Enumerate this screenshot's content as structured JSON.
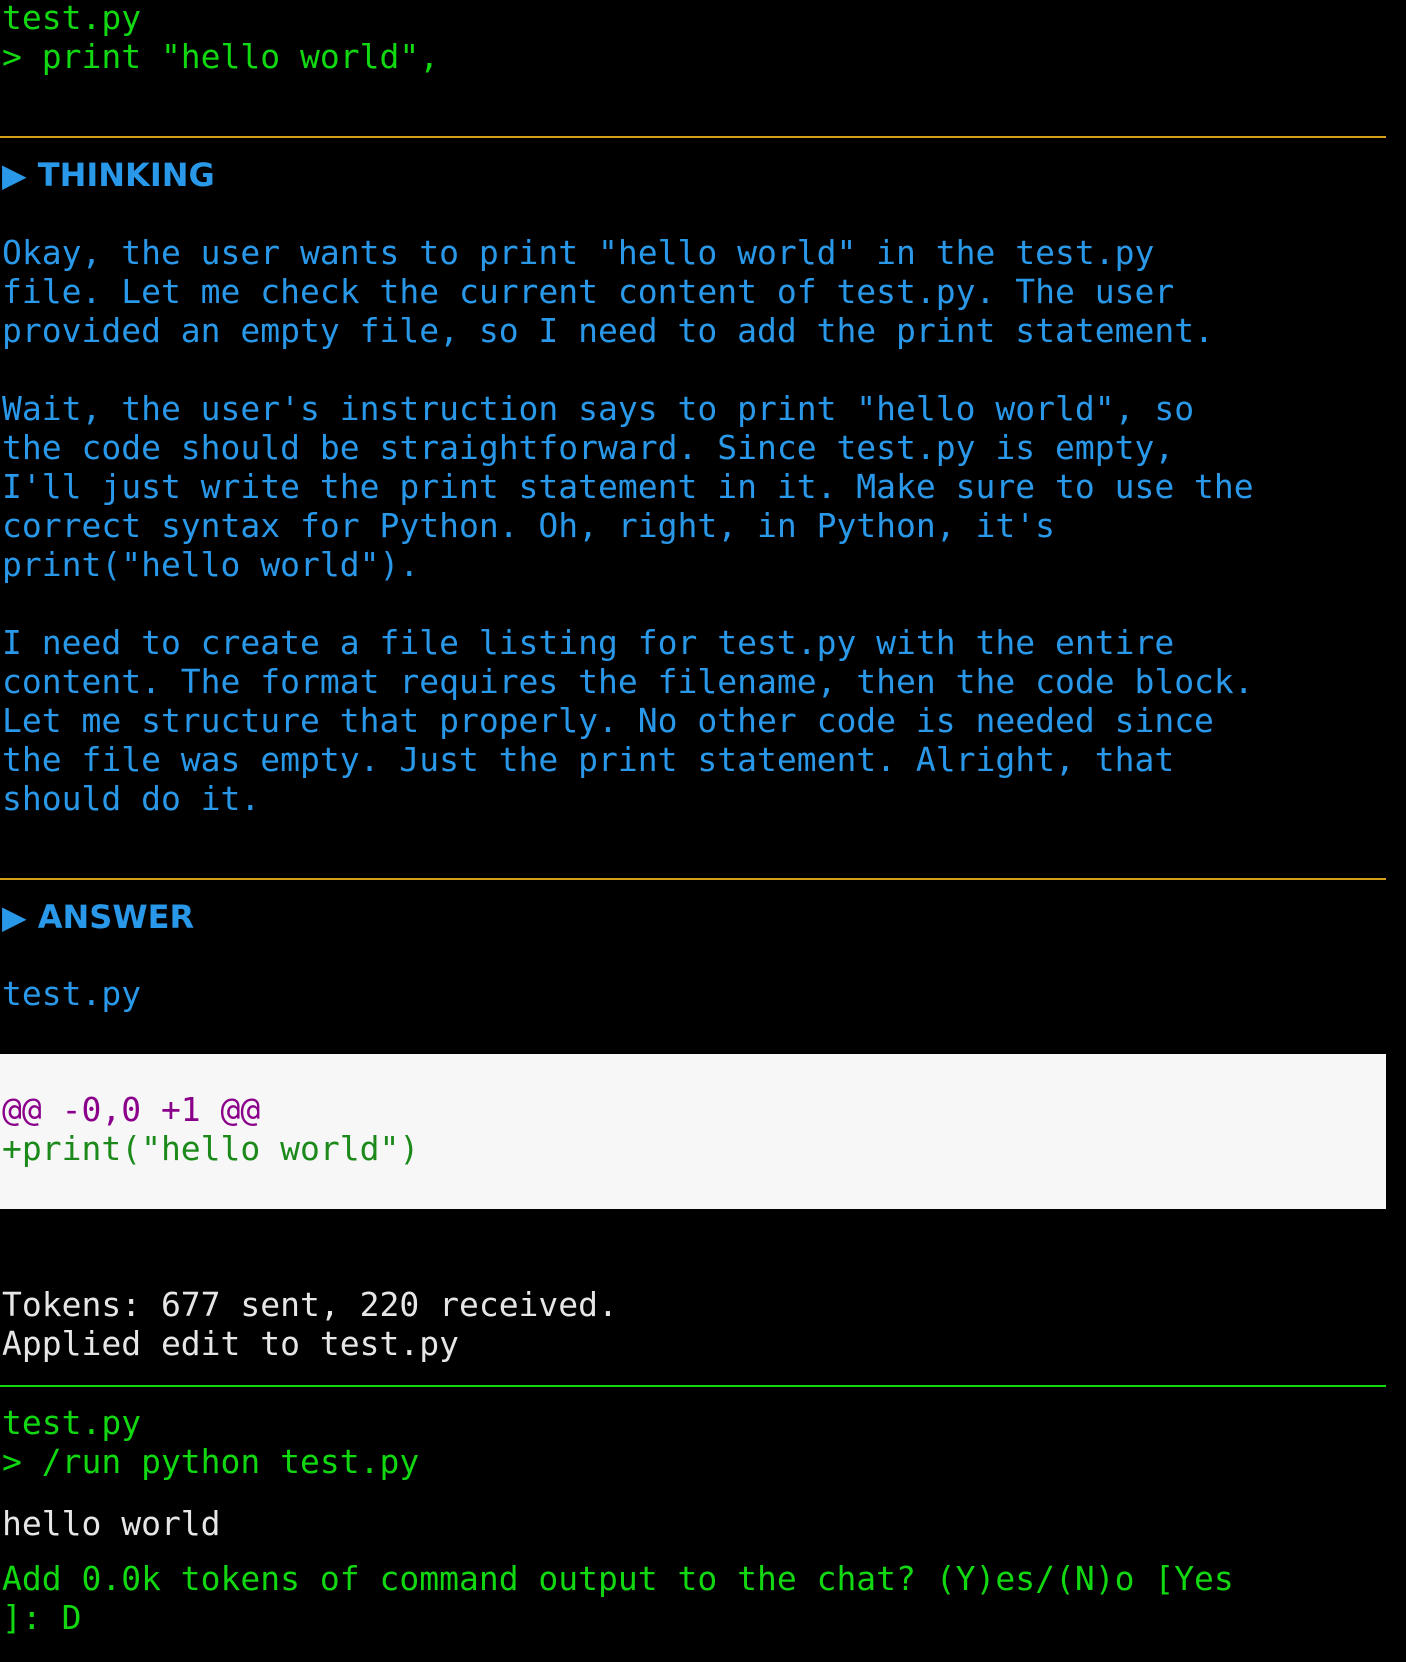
{
  "prompt1": {
    "filename": "test.py",
    "command": "> print \"hello world\","
  },
  "thinking": {
    "heading": "▶ THINKING",
    "para1": [
      "Okay, the user wants to print \"hello world\" in the test.py",
      "file. Let me check the current content of test.py. The user",
      "provided an empty file, so I need to add the print statement."
    ],
    "para2": [
      "Wait, the user's instruction says to print \"hello world\", so",
      "the code should be straightforward. Since test.py is empty,",
      "I'll just write the print statement in it. Make sure to use the",
      "correct syntax for Python. Oh, right, in Python, it's",
      "print(\"hello world\")."
    ],
    "para3": [
      "I need to create a file listing for test.py with the entire",
      "content. The format requires the filename, then the code block.",
      "Let me structure that properly. No other code is needed since",
      "the file was empty. Just the print statement. Alright, that",
      "should do it."
    ]
  },
  "answer": {
    "heading": "▶ ANSWER",
    "filename": "test.py",
    "diff": {
      "hunk_header": "@@ -0,0 +1 @@",
      "added_line": "+print(\"hello world\")"
    }
  },
  "status": {
    "tokens": "Tokens: 677 sent, 220 received.",
    "applied": "Applied edit to test.py"
  },
  "prompt2": {
    "filename": "test.py",
    "command": "> /run python test.py"
  },
  "output": {
    "result": "hello world",
    "question_line1": "Add 0.0k tokens of command output to the chat? (Y)es/(N)o [Yes",
    "question_line2": "]: D"
  },
  "colors": {
    "background": "#000000",
    "prompt_green": "#11d811",
    "thinking_blue": "#2a98e8",
    "rule_amber": "#d4a017",
    "diff_hunk_purple": "#8b008b",
    "diff_add_green": "#1b8a1b",
    "diff_background": "#f7f7f7"
  }
}
